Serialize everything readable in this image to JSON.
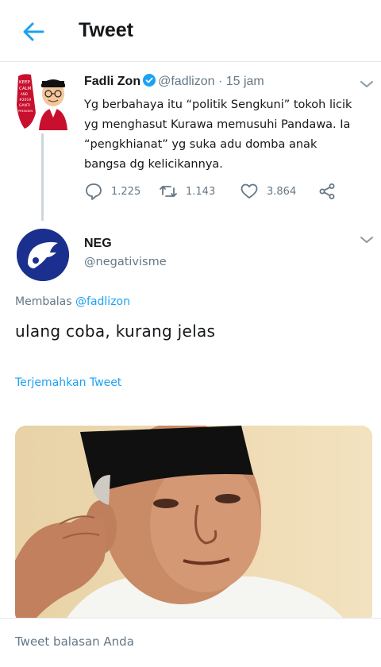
{
  "header": {
    "title": "Tweet"
  },
  "parent_tweet": {
    "name": "Fadli Zon",
    "handle": "@fadlizon",
    "separator": "·",
    "time": "15 jam",
    "avatar_text": [
      "KEEP",
      "CALM",
      "AND",
      "#2019",
      "GANTI",
      "PRESIDEN"
    ],
    "text": "Yg berbahaya itu “politik Sengkuni” tokoh licik yg menghasut Kurawa memusuhi Pandawa. Ia “pengkhianat” yg suka adu domba anak bangsa dg kelicikannya.",
    "replies": "1.225",
    "retweets": "1.143",
    "likes": "3.864"
  },
  "reply": {
    "name": "NEG",
    "handle": "@negativisme",
    "replying_prefix": "Membalas",
    "replying_to": "@fadlizon",
    "text": "ulang coba,  kurang jelas",
    "translate": "Terjemahkan Tweet"
  },
  "composer": {
    "placeholder": "Tweet balasan Anda"
  },
  "colors": {
    "accent": "#1da1f2",
    "muted": "#657786",
    "divider": "#e1e8ed"
  }
}
